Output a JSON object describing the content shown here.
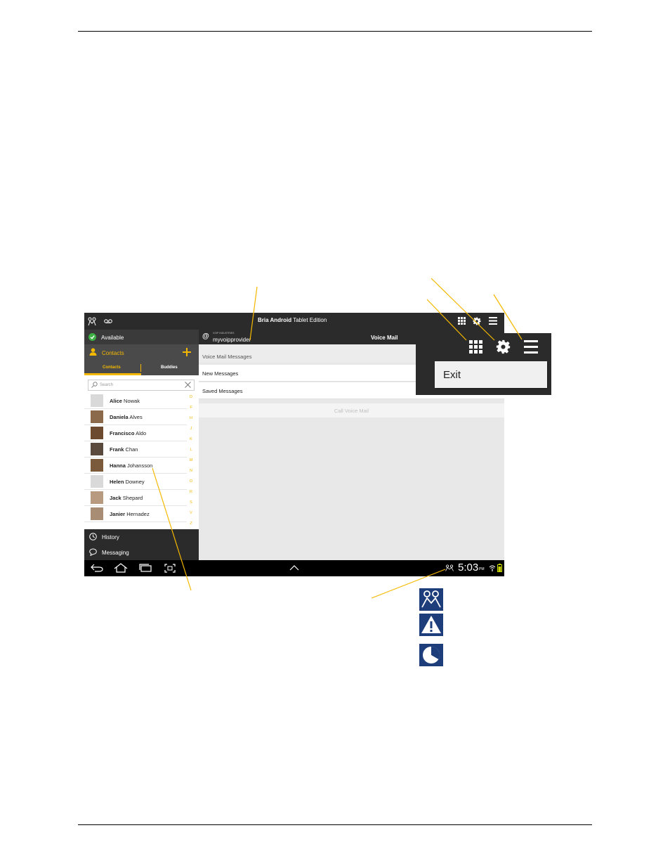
{
  "app": {
    "brand_bold": "Bria Android",
    "brand_rest": " Tablet Edition"
  },
  "left": {
    "status": "Available",
    "contacts_label": "Contacts",
    "tabs": [
      "Contacts",
      "Buddies"
    ],
    "search_placeholder": "Search",
    "contacts": [
      {
        "first": "Alice",
        "last": " Nowak"
      },
      {
        "first": "Daniela",
        "last": " Alves"
      },
      {
        "first": "Francisco",
        "last": " Aldo"
      },
      {
        "first": "Frank",
        "last": " Chan"
      },
      {
        "first": "Hanna",
        "last": " Johansson"
      },
      {
        "first": "Helen",
        "last": " Downey"
      },
      {
        "first": "Jack",
        "last": " Shepard"
      },
      {
        "first": "Janier",
        "last": " Hernadez"
      }
    ],
    "alpha_index": [
      "D",
      "F",
      "H",
      "J",
      "K",
      "L",
      "M",
      "N",
      "O",
      "R",
      "S",
      "V",
      "Z"
    ],
    "history_label": "History",
    "messaging_label": "Messaging"
  },
  "right": {
    "account_small": "VOIP INDUSTRIES",
    "account_name": "myvoipprovider",
    "panel_title": "Voice Mail",
    "section_header": "Voice Mail Messages",
    "items": [
      "New Messages",
      "Saved Messages"
    ],
    "call_voice_mail": "Call Voice Mail"
  },
  "system_bar": {
    "time": "5:03",
    "ampm": "PM"
  },
  "zoom_menu": {
    "exit_label": "Exit"
  },
  "colors": {
    "accent": "#f5b800",
    "dark_bar": "#2b2b2b",
    "legend_blue": "#1d3e7a",
    "callout": "#f5b800"
  },
  "icons": [
    "bria-logo-icon",
    "voicemail-icon",
    "dialpad-icon",
    "gear-icon",
    "menu-icon",
    "check-icon",
    "person-icon",
    "add-icon",
    "search-icon",
    "clear-icon",
    "clock-icon",
    "chat-icon",
    "back-icon",
    "home-icon",
    "recent-apps-icon",
    "screenshot-icon",
    "up-arrow-icon",
    "wifi-icon",
    "battery-icon",
    "presence-icon",
    "warning-icon",
    "pie-icon"
  ]
}
